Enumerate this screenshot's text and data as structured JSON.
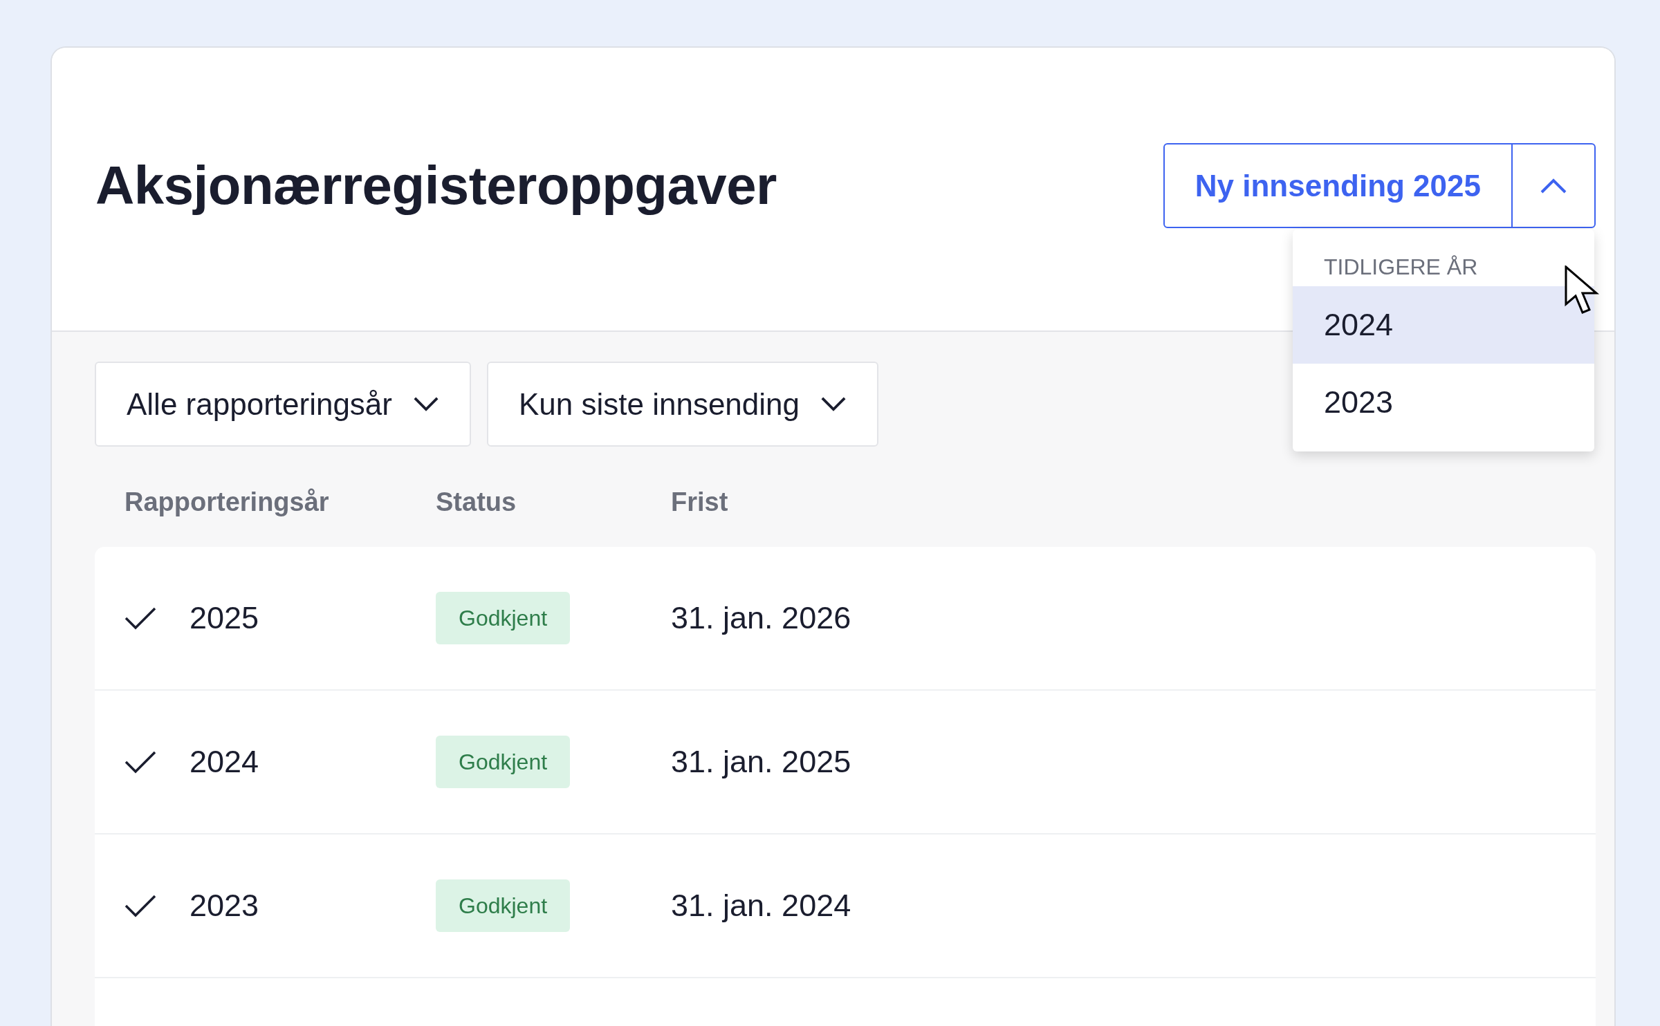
{
  "page": {
    "title": "Aksjonærregisteroppgaver"
  },
  "new_button": {
    "label": "Ny innsending 2025",
    "expanded": true
  },
  "dropdown": {
    "header": "TIDLIGERE ÅR",
    "items": [
      {
        "label": "2024",
        "selected": true
      },
      {
        "label": "2023",
        "selected": false
      }
    ]
  },
  "filters": [
    {
      "label": "Alle rapporteringsår"
    },
    {
      "label": "Kun siste innsending"
    }
  ],
  "table": {
    "columns": [
      "Rapporteringsår",
      "Status",
      "Frist"
    ],
    "rows": [
      {
        "year": "2025",
        "status": "Godkjent",
        "deadline": "31. jan. 2026"
      },
      {
        "year": "2024",
        "status": "Godkjent",
        "deadline": "31. jan. 2025"
      },
      {
        "year": "2023",
        "status": "Godkjent",
        "deadline": "31. jan. 2024"
      }
    ]
  }
}
